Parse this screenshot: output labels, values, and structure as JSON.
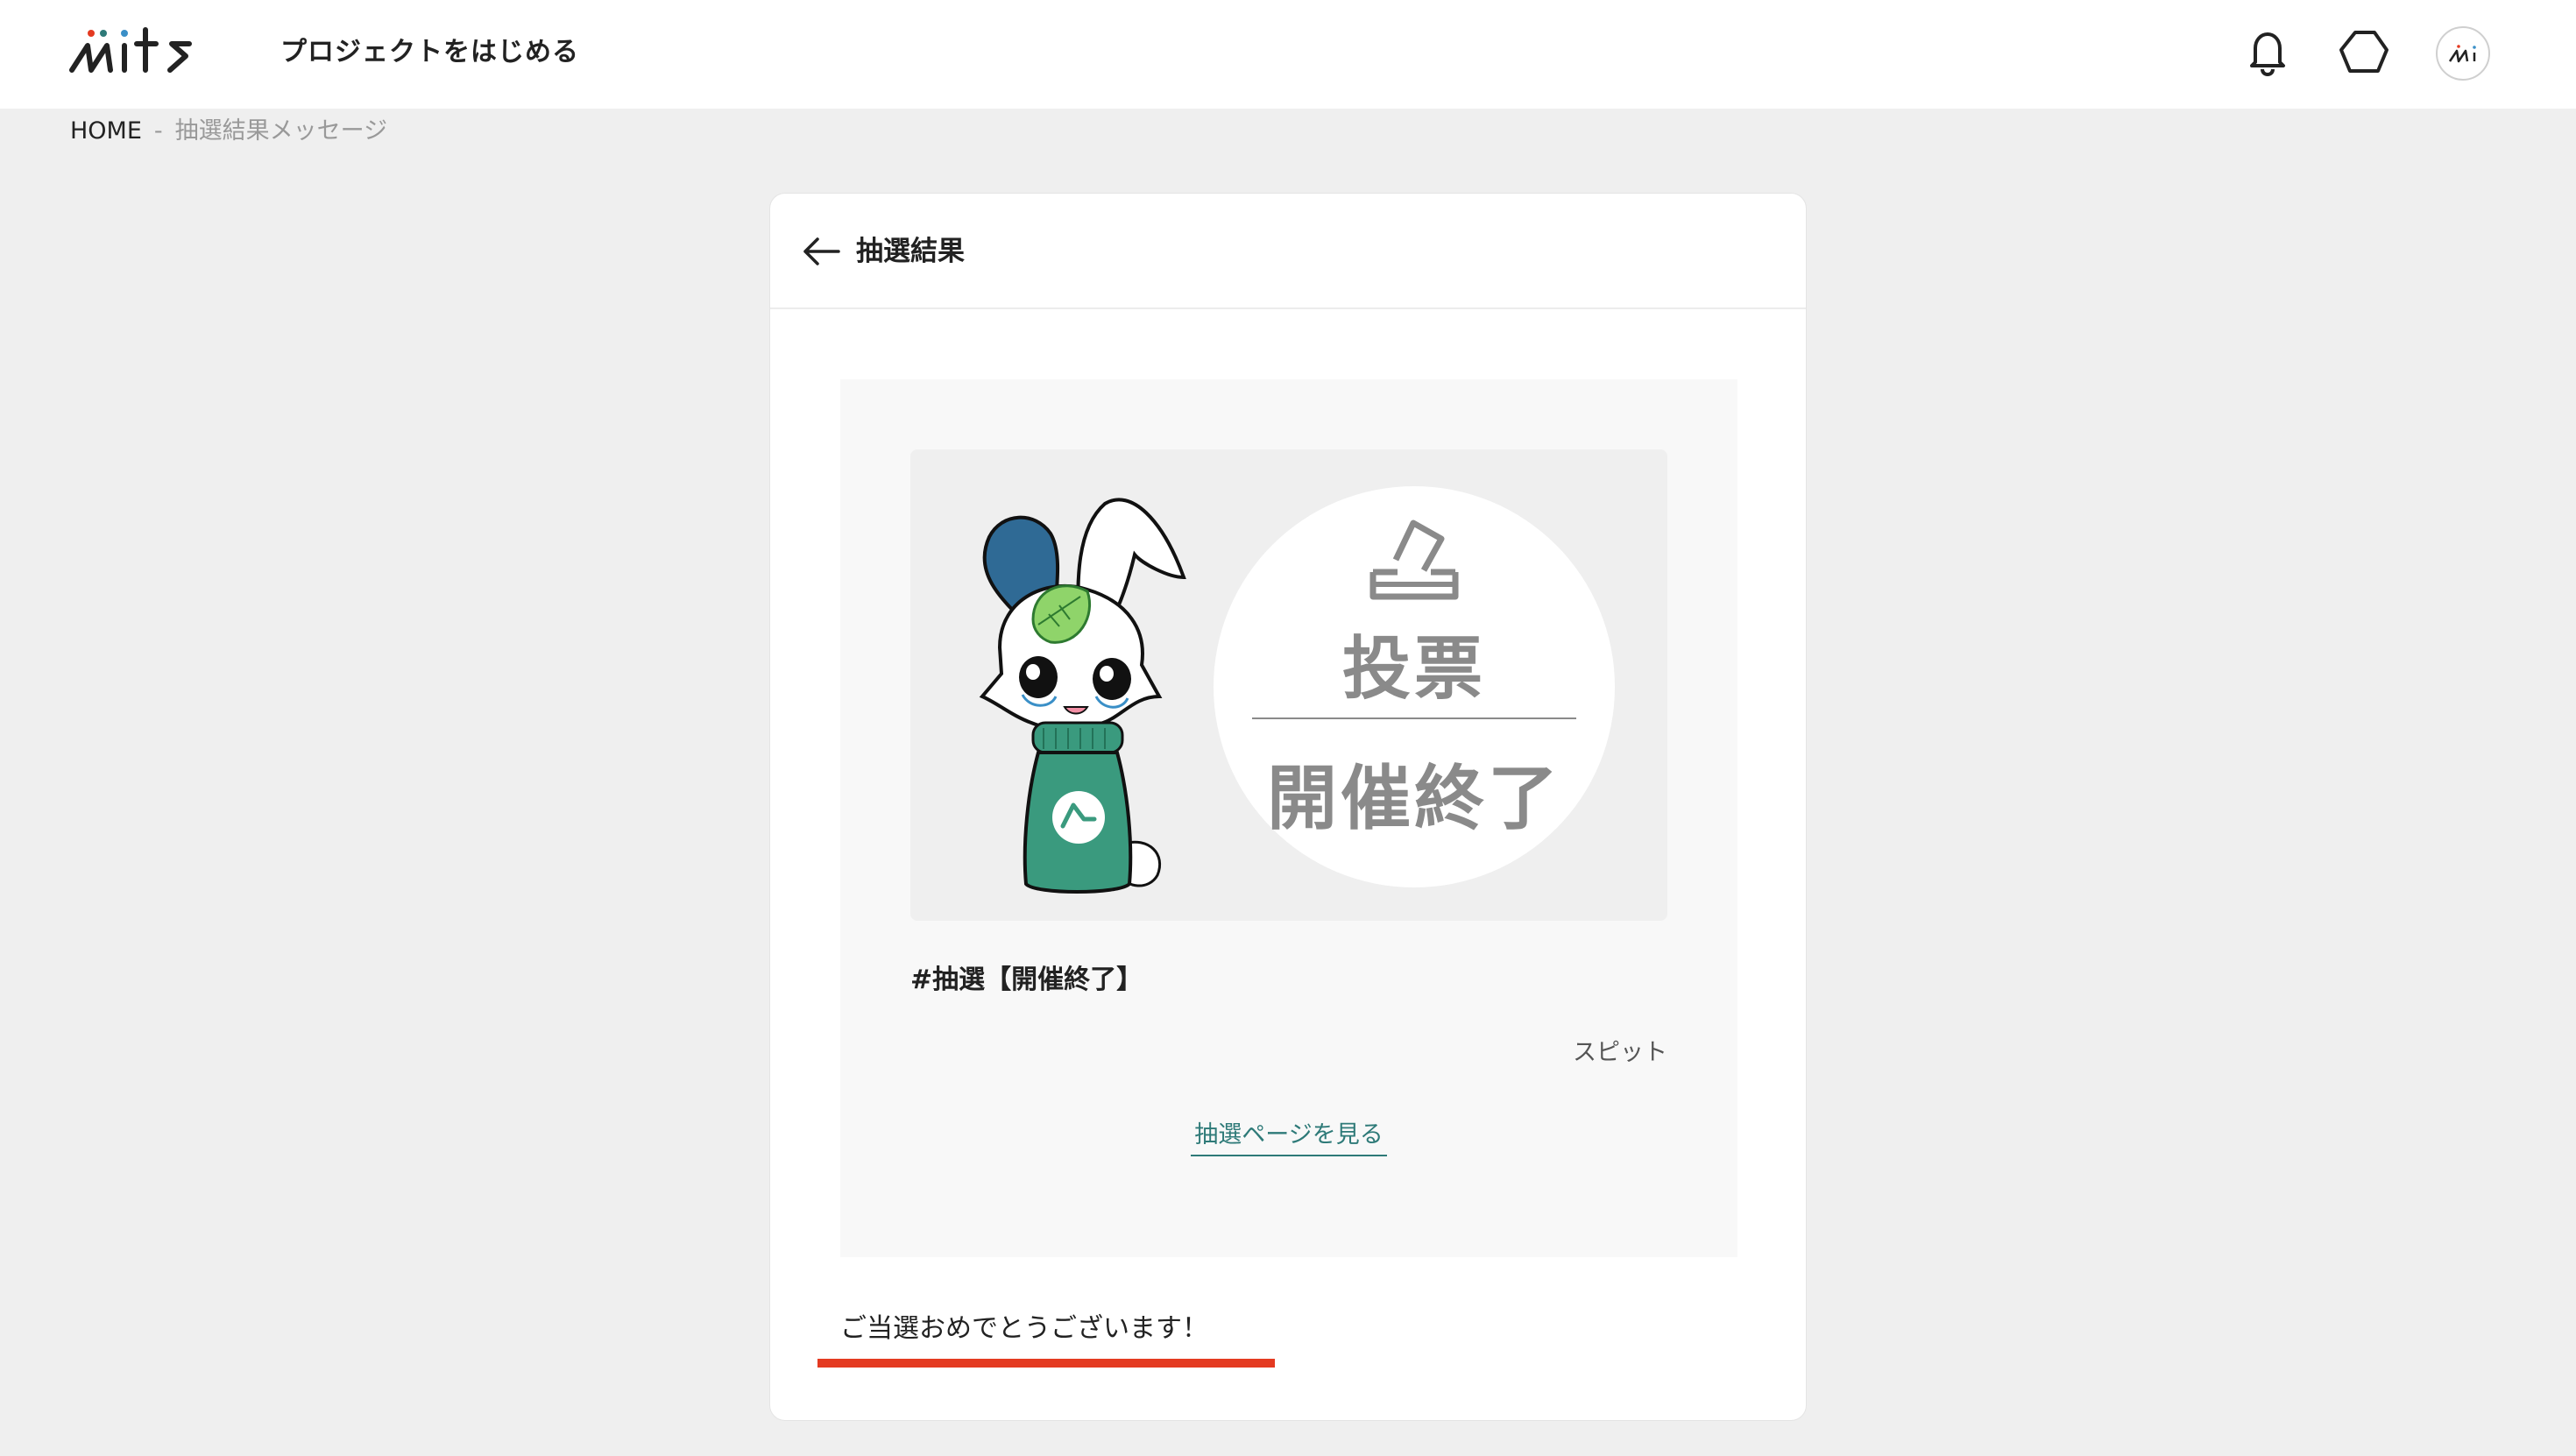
{
  "header": {
    "logo_text": "mits",
    "start_project_label": "プロジェクトをはじめる",
    "icons": [
      "bell-icon",
      "hexagon-icon",
      "avatar"
    ]
  },
  "breadcrumb": {
    "home": "HOME",
    "separator": "-",
    "current": "抽選結果メッセージ"
  },
  "card": {
    "title": "抽選結果",
    "thumbnail": {
      "vote_label": "投票",
      "closed_label": "開催終了"
    },
    "project_title": "#抽選【開催終了】",
    "author": "スピット",
    "view_link_label": "抽選ページを見る",
    "message": "ご当選おめでとうございます！"
  },
  "colors": {
    "accent_teal": "#2e7a78",
    "underline_red": "#e43a21",
    "page_bg": "#efefef"
  }
}
